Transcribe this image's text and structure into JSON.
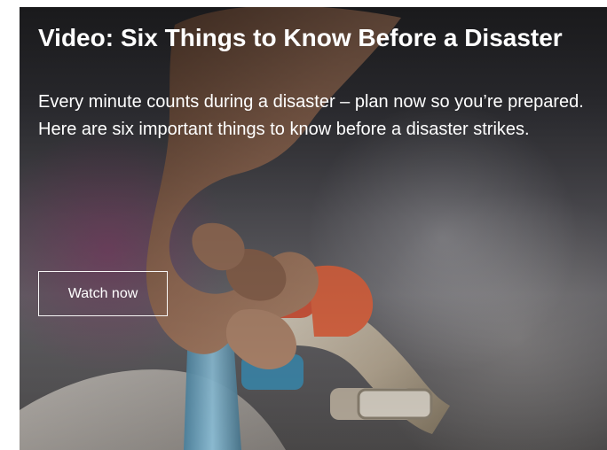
{
  "hero": {
    "title": "Video: Six Things to Know Before a Disaster",
    "summary": "Every minute counts during a disaster – plan now so you’re prepared. Here are six important things to know before a disaster strikes.",
    "button_label": "Watch now",
    "background": {
      "image_description_icon": "faucet-hand-image",
      "accent_colors": {
        "magenta": "#913770",
        "faucet_handle": "#d85a3f",
        "pipe": "#74aac8"
      }
    }
  }
}
